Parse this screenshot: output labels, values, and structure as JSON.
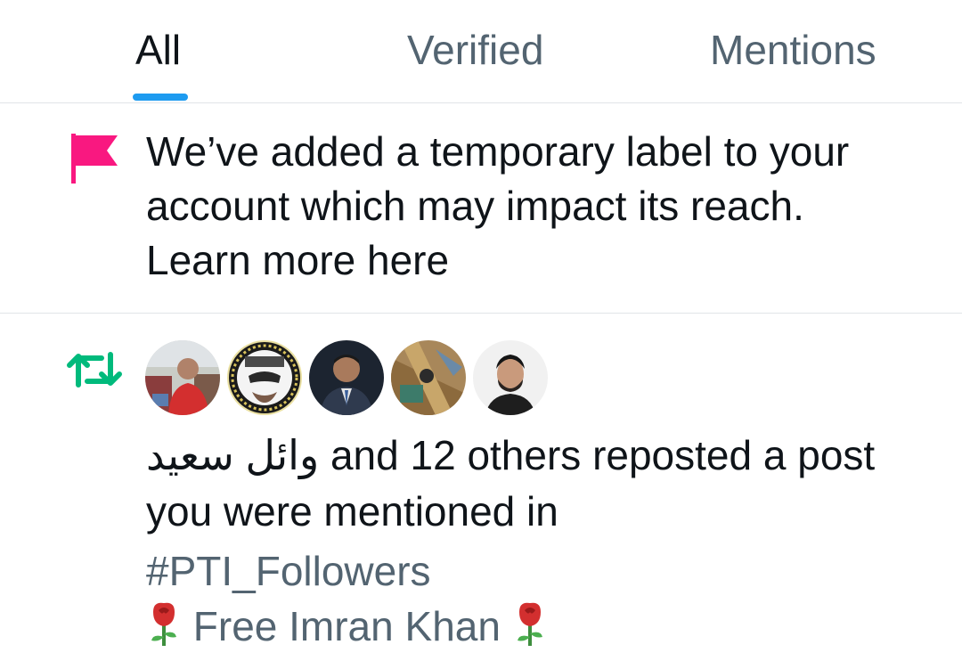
{
  "tabs": [
    {
      "label": "All",
      "active": true
    },
    {
      "label": "Verified",
      "active": false
    },
    {
      "label": "Mentions",
      "active": false
    }
  ],
  "notice": {
    "line1": "We’ve added a temporary label to your",
    "line2": "account which may impact its reach.",
    "link": "Learn more here",
    "icon": "flag-icon",
    "icon_color": "#f91880"
  },
  "repost_notification": {
    "icon": "repost-icon",
    "icon_color": "#00ba7c",
    "user_name": "وائل سعيد",
    "text_line1": "and 12 others reposted a post",
    "text_line2": "you were mentioned in",
    "hashtag": "#PTI_Followers",
    "post_text": "Free Imran Khan",
    "post_emoji": "rose-emoji"
  },
  "colors": {
    "accent": "#1d9bf0",
    "text_primary": "#0f1419",
    "text_secondary": "#536471",
    "divider": "#e1e4e8"
  }
}
